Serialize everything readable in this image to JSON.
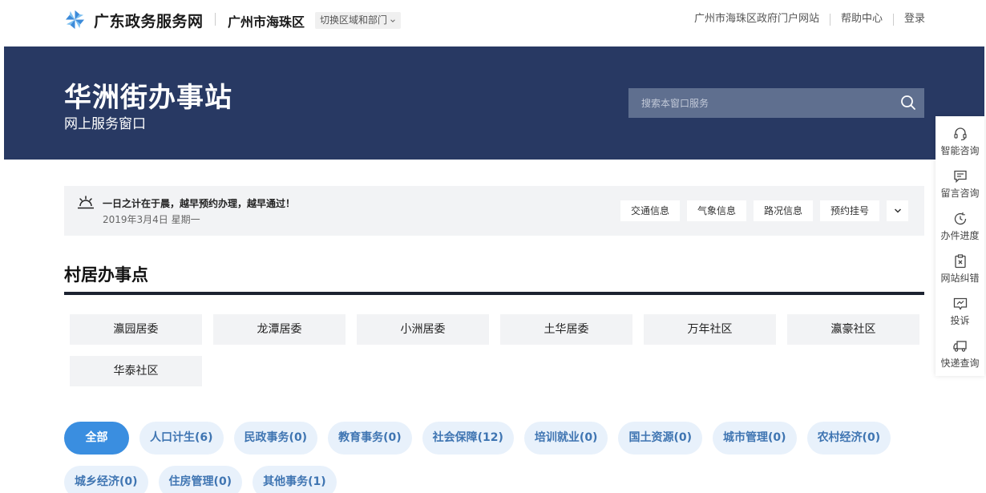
{
  "header": {
    "brand": "广东政务服务网",
    "region": "广州市海珠区",
    "switch_label": "切换区域和部门",
    "links": [
      "广州市海珠区政府门户网站",
      "帮助中心",
      "登录"
    ]
  },
  "banner": {
    "title": "华洲街办事站",
    "subtitle": "网上服务窗口",
    "search_placeholder": "搜索本窗口服务"
  },
  "notice": {
    "message": "一日之计在于晨，越早预约办理，越早通过！",
    "date": "2019年3月4日 星期一",
    "quick_links": [
      "交通信息",
      "气象信息",
      "路况信息",
      "预约挂号"
    ]
  },
  "villages": {
    "title": "村居办事点",
    "items": [
      "瀛园居委",
      "龙潭居委",
      "小洲居委",
      "土华居委",
      "万年社区",
      "瀛豪社区",
      "华泰社区"
    ]
  },
  "categories": {
    "items": [
      "全部",
      "人口计生(6)",
      "民政事务(0)",
      "教育事务(0)",
      "社会保障(12)",
      "培训就业(0)",
      "国土资源(0)",
      "城市管理(0)",
      "农村经济(0)",
      "城乡经济(0)",
      "住房管理(0)",
      "其他事务(1)"
    ],
    "active_index": 0
  },
  "float_bar": {
    "items": [
      {
        "label": "智能咨询",
        "icon": "headset-icon"
      },
      {
        "label": "留言咨询",
        "icon": "message-icon"
      },
      {
        "label": "办件进度",
        "icon": "progress-clock-icon"
      },
      {
        "label": "网站纠错",
        "icon": "clipboard-x-icon"
      },
      {
        "label": "投诉",
        "icon": "complaint-icon"
      },
      {
        "label": "快递查询",
        "icon": "truck-icon"
      }
    ]
  },
  "colors": {
    "banner_bg": "#283963",
    "accent": "#3a8ee0",
    "pill_bg": "#e8f1fb",
    "pill_text": "#3f75b2"
  }
}
